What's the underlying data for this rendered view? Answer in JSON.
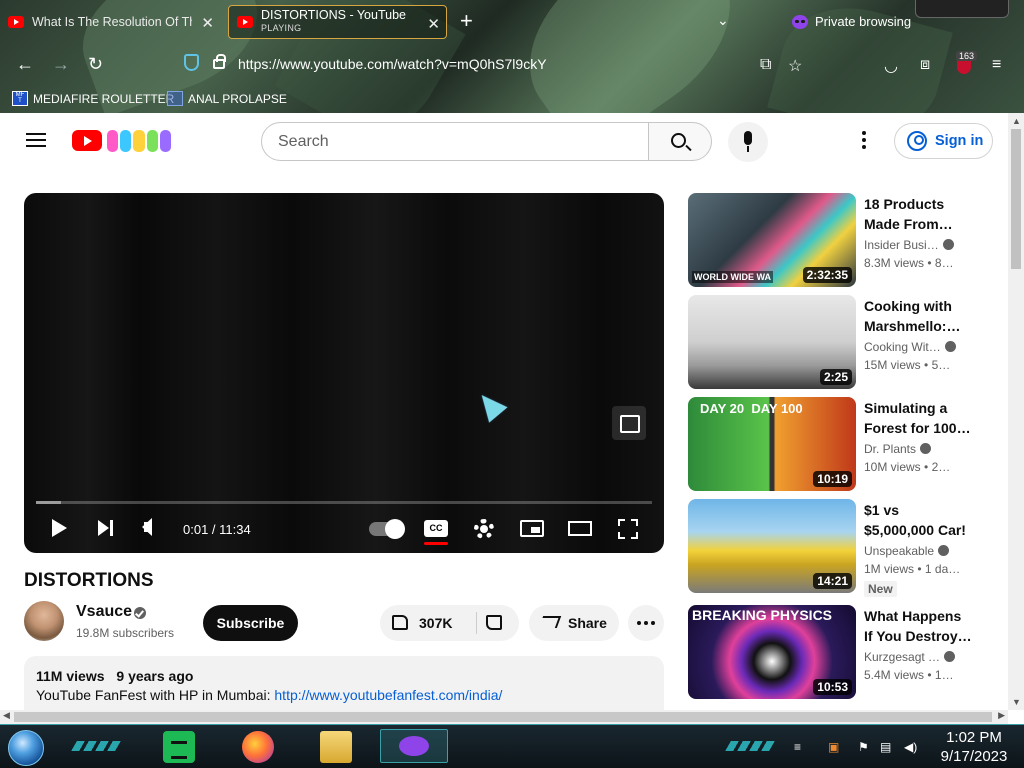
{
  "browser": {
    "tabs": [
      {
        "title": "What Is The Resolution Of The",
        "sublabel": ""
      },
      {
        "title": "DISTORTIONS - YouTube",
        "sublabel": "PLAYING"
      }
    ],
    "private_label": "Private browsing",
    "url": "https://www.youtube.com/watch?v=mQ0hS7l9ckY",
    "extension_badge": "163",
    "bookmarks": [
      "MEDIAFIRE ROULETTER",
      "ANAL PROLAPSE"
    ]
  },
  "youtube": {
    "search_placeholder": "Search",
    "sign_in": "Sign in",
    "player": {
      "time": "0:01 / 11:34",
      "cc_label": "CC",
      "progress_fraction": 0.04
    },
    "video": {
      "title": "DISTORTIONS",
      "channel": "Vsauce",
      "subscribers": "19.8M subscribers",
      "subscribe_label": "Subscribe",
      "likes": "307K",
      "share_label": "Share",
      "views": "11M views",
      "age": "9 years ago",
      "description_text": "YouTube FanFest with HP in Mumbai: ",
      "description_link": "http://www.youtubefanfest.com/india/"
    },
    "recommendations": [
      {
        "title_line1": "18 Products",
        "title_line2": "Made From…",
        "channel": "Insider Busi…",
        "views": "8.3M views",
        "age": "• 8…",
        "duration": "2:32:35",
        "thumb_text": "WORLD WIDE WA",
        "badge": ""
      },
      {
        "title_line1": "Cooking with",
        "title_line2": "Marshmello:…",
        "channel": "Cooking Wit…",
        "views": "15M views",
        "age": "• 5…",
        "duration": "2:25",
        "thumb_text": "",
        "badge": ""
      },
      {
        "title_line1": "Simulating a",
        "title_line2": "Forest for 100…",
        "channel": "Dr. Plants",
        "views": "10M views",
        "age": "• 2…",
        "duration": "10:19",
        "thumb_text": "DAY 20  DAY 100",
        "badge": ""
      },
      {
        "title_line1": "$1 vs",
        "title_line2": "$5,000,000 Car!",
        "channel": "Unspeakable",
        "views": "1M views",
        "age": "• 1 da…",
        "duration": "14:21",
        "thumb_text": "",
        "badge": "New"
      },
      {
        "title_line1": "What Happens",
        "title_line2": "If You Destroy…",
        "channel": "Kurzgesagt …",
        "views": "5.4M views",
        "age": "• 1…",
        "duration": "10:53",
        "thumb_text": "BREAKING PHYSICS",
        "badge": ""
      }
    ]
  },
  "taskbar": {
    "time": "1:02 PM",
    "date": "9/17/2023"
  }
}
